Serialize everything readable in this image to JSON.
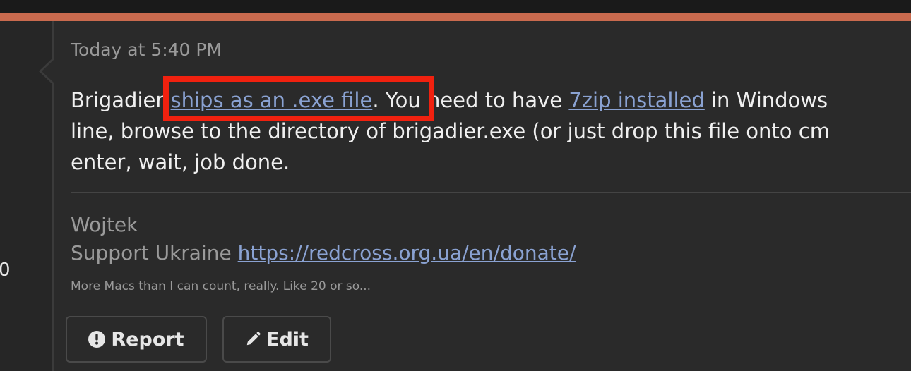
{
  "post": {
    "timestamp": "Today at 5:40 PM",
    "line1_before": "Brigadier ",
    "link1": "ships as an .exe file",
    "line1_middle": ". You need to have ",
    "link2": "7zip installed",
    "line1_after": " in Windows",
    "line2": "line, browse to the directory of brigadier.exe (or just drop this file onto cm",
    "line3": "enter, wait, job done."
  },
  "signature": {
    "name": "Wojtek",
    "support_text": "Support Ukraine ",
    "support_link": "https://redcross.org.ua/en/donate/",
    "tagline": "More Macs than I can count, really. Like 20 or so..."
  },
  "actions": {
    "report_label": "Report",
    "edit_label": "Edit"
  },
  "sidebar": {
    "count_fragment": "0"
  },
  "colors": {
    "accent": "#c96a4e",
    "link": "#8aa2d2",
    "highlight": "#f0210f"
  },
  "icons": {
    "report": "exclamation-circle-icon",
    "edit": "pencil-icon"
  }
}
